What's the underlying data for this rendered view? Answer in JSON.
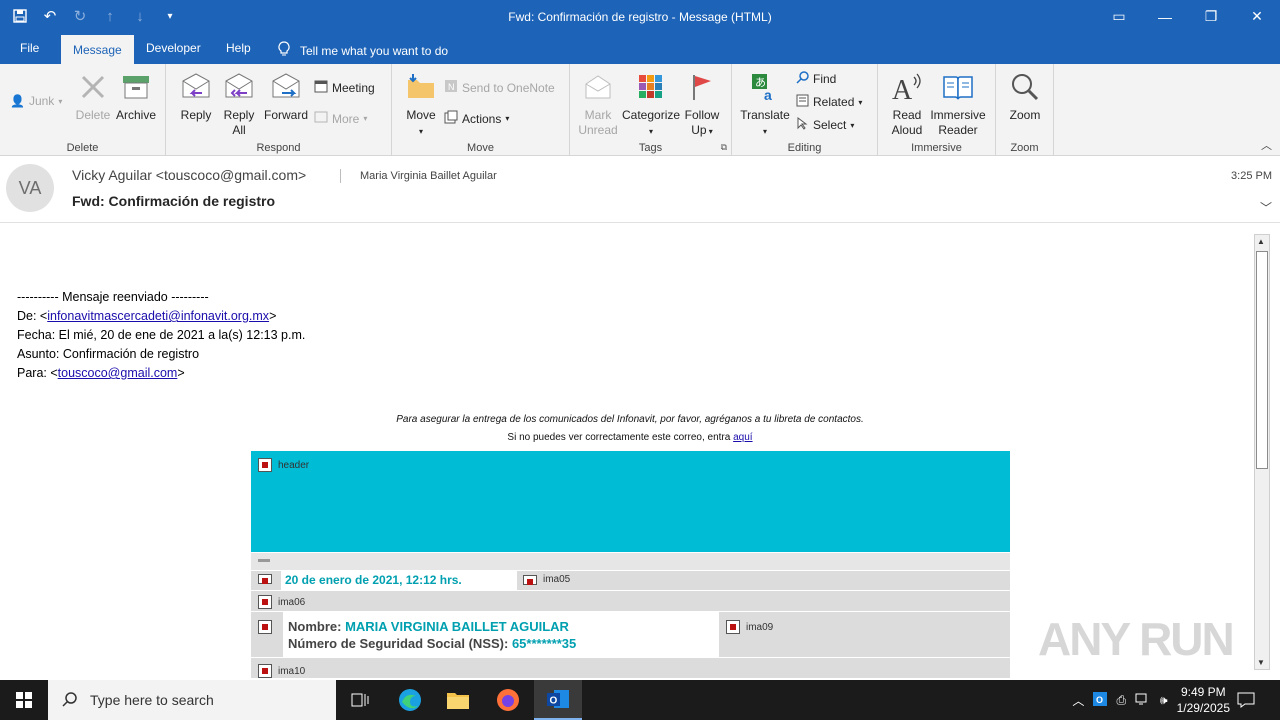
{
  "window": {
    "title": "Fwd: Confirmación de registro  -  Message (HTML)"
  },
  "menu": {
    "tabs": [
      "File",
      "Message",
      "Developer",
      "Help"
    ],
    "active_tab": "Message",
    "tell_me": "Tell me what you want to do"
  },
  "ribbon": {
    "delete_group": {
      "label": "Delete",
      "junk": "Junk",
      "delete": "Delete",
      "archive": "Archive"
    },
    "respond_group": {
      "label": "Respond",
      "reply": "Reply",
      "reply_all_1": "Reply",
      "reply_all_2": "All",
      "forward": "Forward",
      "meeting": "Meeting",
      "more": "More"
    },
    "move_group": {
      "label": "Move",
      "move": "Move",
      "send_onenote": "Send to OneNote",
      "actions": "Actions"
    },
    "tags_group": {
      "label": "Tags",
      "mark_unread_1": "Mark",
      "mark_unread_2": "Unread",
      "categorize": "Categorize",
      "follow_up_1": "Follow",
      "follow_up_2": "Up"
    },
    "editing_group": {
      "label": "Editing",
      "translate": "Translate",
      "find": "Find",
      "related": "Related",
      "select": "Select"
    },
    "immersive_group": {
      "label": "Immersive",
      "read_aloud_1": "Read",
      "read_aloud_2": "Aloud",
      "immersive_reader_1": "Immersive",
      "immersive_reader_2": "Reader"
    },
    "zoom_group": {
      "label": "Zoom",
      "zoom": "Zoom"
    }
  },
  "message": {
    "avatar_initials": "VA",
    "sender": "Vicky Aguilar <touscoco@gmail.com>",
    "recipient": "Maria Virginia Baillet Aguilar",
    "subject": "Fwd: Confirmación de registro",
    "time": "3:25 PM"
  },
  "body": {
    "fwd_header": "---------- Mensaje reenviado ---------",
    "from_prefix": "De: <",
    "from_email": "infonavitmascercadeti@infonavit.org.mx",
    "from_suffix": ">",
    "date_line": "Fecha: El mié, 20 de ene de 2021  a la(s) 12:13 p.m.",
    "subject_line": "Asunto: Confirmación de registro",
    "to_prefix": "Para: <",
    "to_email": "touscoco@gmail.com",
    "to_suffix": ">",
    "notice": "Para asegurar la entrega de los comunicados del Infonavit, por favor, agréganos a tu libreta de contactos.",
    "notice2_prefix": "Si no puedes ver correctamente este correo, entra ",
    "notice2_link": "aquí",
    "header_img": "header",
    "date_text": "20 de enero de 2021, 12:12  hrs.",
    "img_ima05": "ima05",
    "img_ima06": "ima06",
    "nombre_label": "Nombre: ",
    "nombre_value": "MARIA VIRGINIA BAILLET AGUILAR",
    "nss_label": "Número de Seguridad Social (NSS): ",
    "nss_value": "65*******35",
    "img_ima09": "ima09",
    "img_ima10": "ima10"
  },
  "taskbar": {
    "search_placeholder": "Type here to search",
    "time": "9:49 PM",
    "date": "1/29/2025"
  },
  "watermark": "ANY RUN"
}
